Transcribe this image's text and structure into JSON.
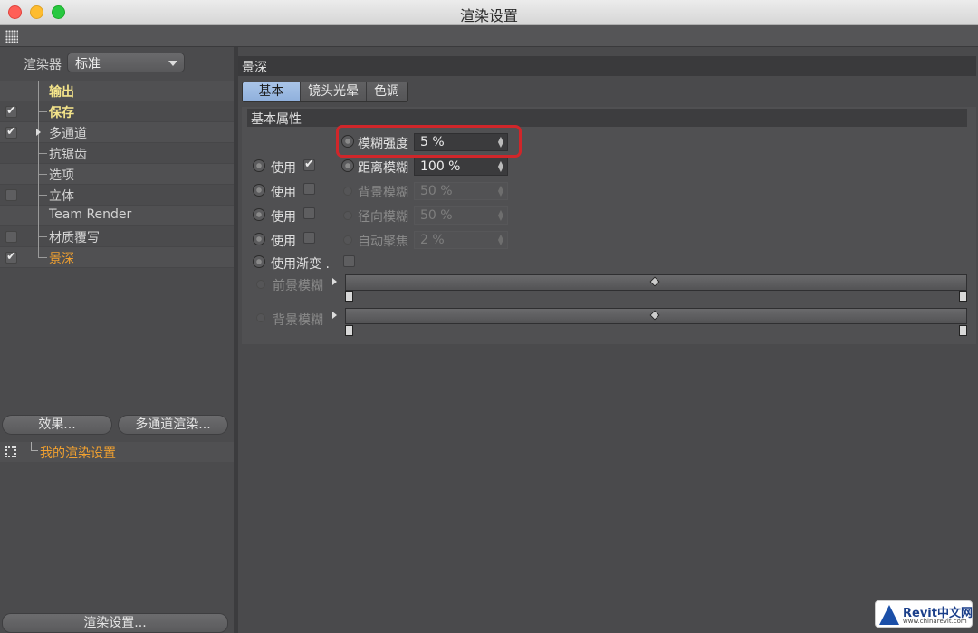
{
  "window": {
    "title": "渲染设置"
  },
  "left": {
    "renderer_label": "渲染器",
    "renderer_value": "标准",
    "tree": [
      {
        "label": "输出",
        "checked": false,
        "has_check": false,
        "style": "yellow"
      },
      {
        "label": "保存",
        "checked": true,
        "has_check": true,
        "style": "yellow"
      },
      {
        "label": "多通道",
        "checked": true,
        "has_check": true,
        "style": "normal",
        "expandable": true
      },
      {
        "label": "抗锯齿",
        "checked": false,
        "has_check": false,
        "style": "normal"
      },
      {
        "label": "选项",
        "checked": false,
        "has_check": false,
        "style": "normal"
      },
      {
        "label": "立体",
        "checked": false,
        "has_check": true,
        "style": "normal"
      },
      {
        "label": "Team Render",
        "checked": false,
        "has_check": false,
        "style": "normal"
      },
      {
        "label": "材质覆写",
        "checked": false,
        "has_check": true,
        "style": "normal"
      },
      {
        "label": "景深",
        "checked": true,
        "has_check": true,
        "style": "orange"
      }
    ],
    "effects_button": "效果...",
    "multipass_button": "多通道渲染...",
    "preset_label": "我的渲染设置",
    "render_settings_button": "渲染设置..."
  },
  "right": {
    "section_title": "景深",
    "tabs": [
      {
        "label": "基本",
        "active": true
      },
      {
        "label": "镜头光晕",
        "active": false
      },
      {
        "label": "色调",
        "active": false
      }
    ],
    "group_title": "基本属性",
    "blur_strength": {
      "label": "模糊强度",
      "value": "5 %"
    },
    "use_label": "使用",
    "distance_blur": {
      "label": "距离模糊",
      "value": "100 %",
      "use_checked": true
    },
    "background_blur": {
      "label": "背景模糊",
      "value": "50 %",
      "use_checked": false
    },
    "radial_blur": {
      "label": "径向模糊",
      "value": "50 %",
      "use_checked": false
    },
    "auto_focus": {
      "label": "自动聚焦",
      "value": "2 %",
      "use_checked": false
    },
    "use_gradient": {
      "label": "使用渐变 .",
      "checked": false
    },
    "foreground_blur_gradient": {
      "label": "前景模糊"
    },
    "background_blur_gradient": {
      "label": "背景模糊"
    }
  },
  "watermark": {
    "brand": "Revit中文网",
    "url": "www.chinarevit.com"
  }
}
